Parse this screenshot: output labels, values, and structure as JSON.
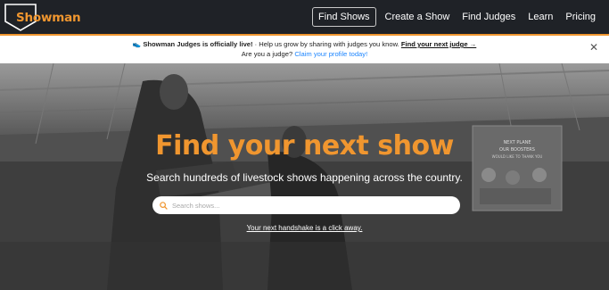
{
  "brand": {
    "name": "Showman",
    "accent": "#f0962f",
    "nav_bg": "#1f2227"
  },
  "nav": {
    "items": [
      {
        "label": "Find Shows",
        "active": true
      },
      {
        "label": "Create a Show",
        "active": false
      },
      {
        "label": "Find Judges",
        "active": false
      },
      {
        "label": "Learn",
        "active": false
      },
      {
        "label": "Pricing",
        "active": false
      }
    ]
  },
  "announcement": {
    "emoji": "👟",
    "headline": "Showman Judges is officially live!",
    "body": " · Help us grow by sharing with judges you know. ",
    "cta": "Find your next judge →",
    "line2_prefix": "Are you a judge? ",
    "line2_link": "Claim your profile today!",
    "close_icon": "close-icon"
  },
  "hero": {
    "title": "Find your next show",
    "subtitle": "Search hundreds of livestock shows happening across the country.",
    "search": {
      "placeholder": "Search shows...",
      "value": "",
      "icon": "search-icon"
    },
    "link": "Your next handshake is a click away."
  },
  "background_sign": {
    "lines": [
      "NEXT PLANE",
      "OUR BOOSTERS",
      "WOULD LIKE TO THANK YOU"
    ]
  }
}
